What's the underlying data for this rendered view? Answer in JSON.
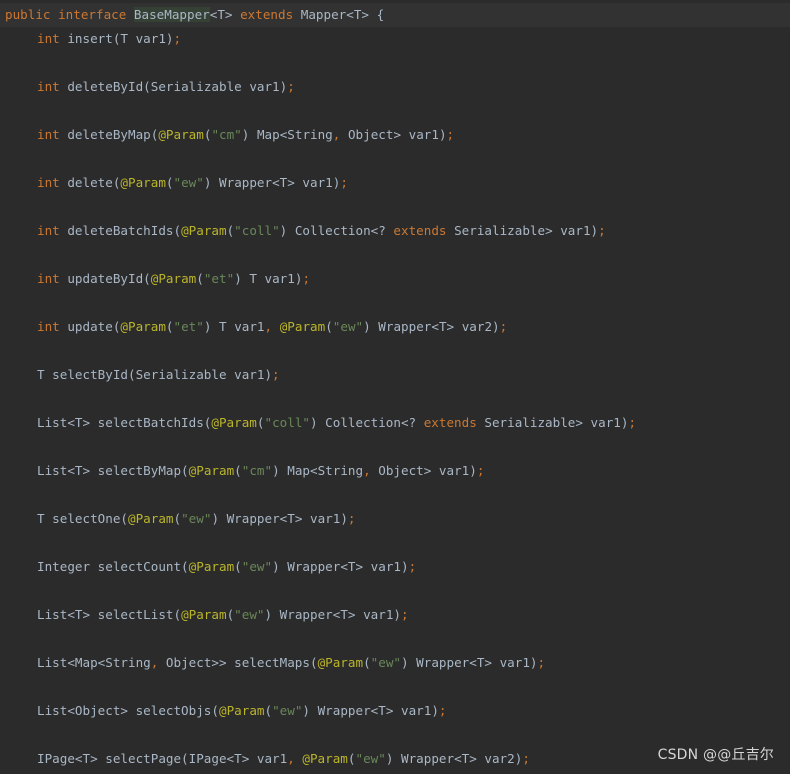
{
  "colors": {
    "background": "#2b2b2b",
    "text": "#a9b7c6",
    "keyword": "#cc7832",
    "string": "#6a8759",
    "annotation": "#bbb529",
    "highlight": "#344134"
  },
  "code": {
    "lines": [
      [
        [
          "kw",
          "public interface "
        ],
        [
          "hl",
          "BaseMapper"
        ],
        [
          "plain",
          "<T> "
        ],
        [
          "kw",
          "extends "
        ],
        [
          "plain",
          "Mapper<T> {"
        ]
      ],
      [
        [
          "kw",
          "int "
        ],
        [
          "plain",
          "insert(T var1)"
        ],
        [
          "punc",
          ";"
        ]
      ],
      [
        [
          "kw",
          "int "
        ],
        [
          "plain",
          "deleteById(Serializable var1)"
        ],
        [
          "punc",
          ";"
        ]
      ],
      [
        [
          "kw",
          "int "
        ],
        [
          "plain",
          "deleteByMap("
        ],
        [
          "ann",
          "@Param"
        ],
        [
          "plain",
          "("
        ],
        [
          "str",
          "\"cm\""
        ],
        [
          "plain",
          ") Map<String"
        ],
        [
          "punc",
          ", "
        ],
        [
          "plain",
          "Object> var1)"
        ],
        [
          "punc",
          ";"
        ]
      ],
      [
        [
          "kw",
          "int "
        ],
        [
          "plain",
          "delete("
        ],
        [
          "ann",
          "@Param"
        ],
        [
          "plain",
          "("
        ],
        [
          "str",
          "\"ew\""
        ],
        [
          "plain",
          ") Wrapper<T> var1)"
        ],
        [
          "punc",
          ";"
        ]
      ],
      [
        [
          "kw",
          "int "
        ],
        [
          "plain",
          "deleteBatchIds("
        ],
        [
          "ann",
          "@Param"
        ],
        [
          "plain",
          "("
        ],
        [
          "str",
          "\"coll\""
        ],
        [
          "plain",
          ") Collection<? "
        ],
        [
          "kw",
          "extends "
        ],
        [
          "plain",
          "Serializable> var1)"
        ],
        [
          "punc",
          ";"
        ]
      ],
      [
        [
          "kw",
          "int "
        ],
        [
          "plain",
          "updateById("
        ],
        [
          "ann",
          "@Param"
        ],
        [
          "plain",
          "("
        ],
        [
          "str",
          "\"et\""
        ],
        [
          "plain",
          ") T var1)"
        ],
        [
          "punc",
          ";"
        ]
      ],
      [
        [
          "kw",
          "int "
        ],
        [
          "plain",
          "update("
        ],
        [
          "ann",
          "@Param"
        ],
        [
          "plain",
          "("
        ],
        [
          "str",
          "\"et\""
        ],
        [
          "plain",
          ") T var1"
        ],
        [
          "punc",
          ", "
        ],
        [
          "ann",
          "@Param"
        ],
        [
          "plain",
          "("
        ],
        [
          "str",
          "\"ew\""
        ],
        [
          "plain",
          ") Wrapper<T> var2)"
        ],
        [
          "punc",
          ";"
        ]
      ],
      [
        [
          "plain",
          "T selectById(Serializable var1)"
        ],
        [
          "punc",
          ";"
        ]
      ],
      [
        [
          "plain",
          "List<T> selectBatchIds("
        ],
        [
          "ann",
          "@Param"
        ],
        [
          "plain",
          "("
        ],
        [
          "str",
          "\"coll\""
        ],
        [
          "plain",
          ") Collection<? "
        ],
        [
          "kw",
          "extends "
        ],
        [
          "plain",
          "Serializable> var1)"
        ],
        [
          "punc",
          ";"
        ]
      ],
      [
        [
          "plain",
          "List<T> selectByMap("
        ],
        [
          "ann",
          "@Param"
        ],
        [
          "plain",
          "("
        ],
        [
          "str",
          "\"cm\""
        ],
        [
          "plain",
          ") Map<String"
        ],
        [
          "punc",
          ", "
        ],
        [
          "plain",
          "Object> var1)"
        ],
        [
          "punc",
          ";"
        ]
      ],
      [
        [
          "plain",
          "T selectOne("
        ],
        [
          "ann",
          "@Param"
        ],
        [
          "plain",
          "("
        ],
        [
          "str",
          "\"ew\""
        ],
        [
          "plain",
          ") Wrapper<T> var1)"
        ],
        [
          "punc",
          ";"
        ]
      ],
      [
        [
          "plain",
          "Integer selectCount("
        ],
        [
          "ann",
          "@Param"
        ],
        [
          "plain",
          "("
        ],
        [
          "str",
          "\"ew\""
        ],
        [
          "plain",
          ") Wrapper<T> var1)"
        ],
        [
          "punc",
          ";"
        ]
      ],
      [
        [
          "plain",
          "List<T> selectList("
        ],
        [
          "ann",
          "@Param"
        ],
        [
          "plain",
          "("
        ],
        [
          "str",
          "\"ew\""
        ],
        [
          "plain",
          ") Wrapper<T> var1)"
        ],
        [
          "punc",
          ";"
        ]
      ],
      [
        [
          "plain",
          "List<Map<String"
        ],
        [
          "punc",
          ", "
        ],
        [
          "plain",
          "Object>> selectMaps("
        ],
        [
          "ann",
          "@Param"
        ],
        [
          "plain",
          "("
        ],
        [
          "str",
          "\"ew\""
        ],
        [
          "plain",
          ") Wrapper<T> var1)"
        ],
        [
          "punc",
          ";"
        ]
      ],
      [
        [
          "plain",
          "List<Object> selectObjs("
        ],
        [
          "ann",
          "@Param"
        ],
        [
          "plain",
          "("
        ],
        [
          "str",
          "\"ew\""
        ],
        [
          "plain",
          ") Wrapper<T> var1)"
        ],
        [
          "punc",
          ";"
        ]
      ],
      [
        [
          "plain",
          "IPage<T> selectPage(IPage<T> var1"
        ],
        [
          "punc",
          ", "
        ],
        [
          "ann",
          "@Param"
        ],
        [
          "plain",
          "("
        ],
        [
          "str",
          "\"ew\""
        ],
        [
          "plain",
          ") Wrapper<T> var2)"
        ],
        [
          "punc",
          ";"
        ]
      ]
    ]
  },
  "watermark": "CSDN @@丘吉尔"
}
